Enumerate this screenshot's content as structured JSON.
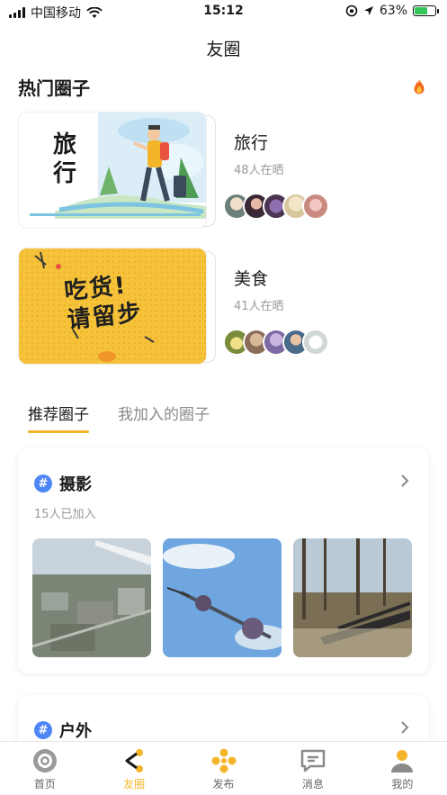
{
  "status": {
    "carrier": "中国移动",
    "time": "15:12",
    "battery": "63%",
    "battery_level": 0.63
  },
  "nav": {
    "title": "友圈"
  },
  "hot": {
    "title": "热门圈子",
    "icon": "flame-icon",
    "items": [
      {
        "name": "旅行",
        "count": "48人在晒",
        "image_text": "旅\n行"
      },
      {
        "name": "美食",
        "count": "41人在晒",
        "image_text": "吃货!请留步"
      }
    ]
  },
  "tabs": [
    {
      "label": "推荐圈子",
      "active": true
    },
    {
      "label": "我加入的圈子",
      "active": false
    }
  ],
  "groups": [
    {
      "name": "摄影",
      "members": "15人已加入"
    },
    {
      "name": "户外",
      "members": ""
    }
  ],
  "tabbar": [
    {
      "label": "首页",
      "icon": "home-icon",
      "active": false
    },
    {
      "label": "友圈",
      "icon": "share-icon",
      "active": true
    },
    {
      "label": "发布",
      "icon": "publish-icon",
      "active": false
    },
    {
      "label": "消息",
      "icon": "message-icon",
      "active": false
    },
    {
      "label": "我的",
      "icon": "profile-icon",
      "active": false
    }
  ],
  "colors": {
    "accent": "#f5b52a",
    "hashtag": "#4f86f7",
    "muted": "#9a9a9a",
    "battery": "#33c759"
  }
}
